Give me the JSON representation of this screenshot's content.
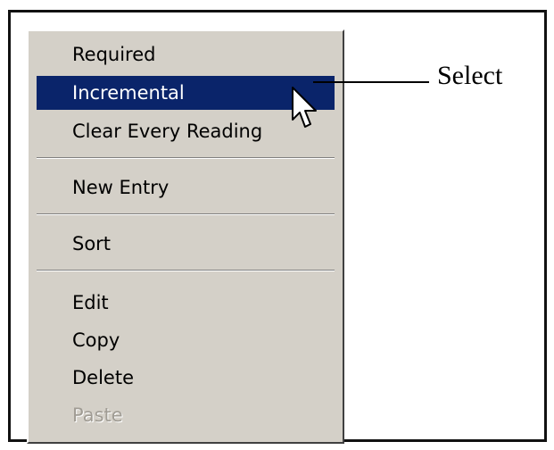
{
  "context_menu": {
    "items": [
      {
        "label": "Required",
        "state": "normal"
      },
      {
        "label": "Incremental",
        "state": "highlighted"
      },
      {
        "label": "Clear Every Reading",
        "state": "normal"
      },
      {
        "label": "New Entry",
        "state": "normal"
      },
      {
        "label": "Sort",
        "state": "normal"
      },
      {
        "label": "Edit",
        "state": "normal"
      },
      {
        "label": "Copy",
        "state": "normal"
      },
      {
        "label": "Delete",
        "state": "normal"
      },
      {
        "label": "Paste",
        "state": "disabled"
      }
    ]
  },
  "annotation": {
    "label": "Select"
  },
  "colors": {
    "menu_background": "#d4d0c8",
    "highlight": "#0a246a",
    "highlight_text": "#ffffff",
    "disabled_text": "#a09c94"
  },
  "icons": {
    "cursor": "arrow-pointer-icon"
  }
}
